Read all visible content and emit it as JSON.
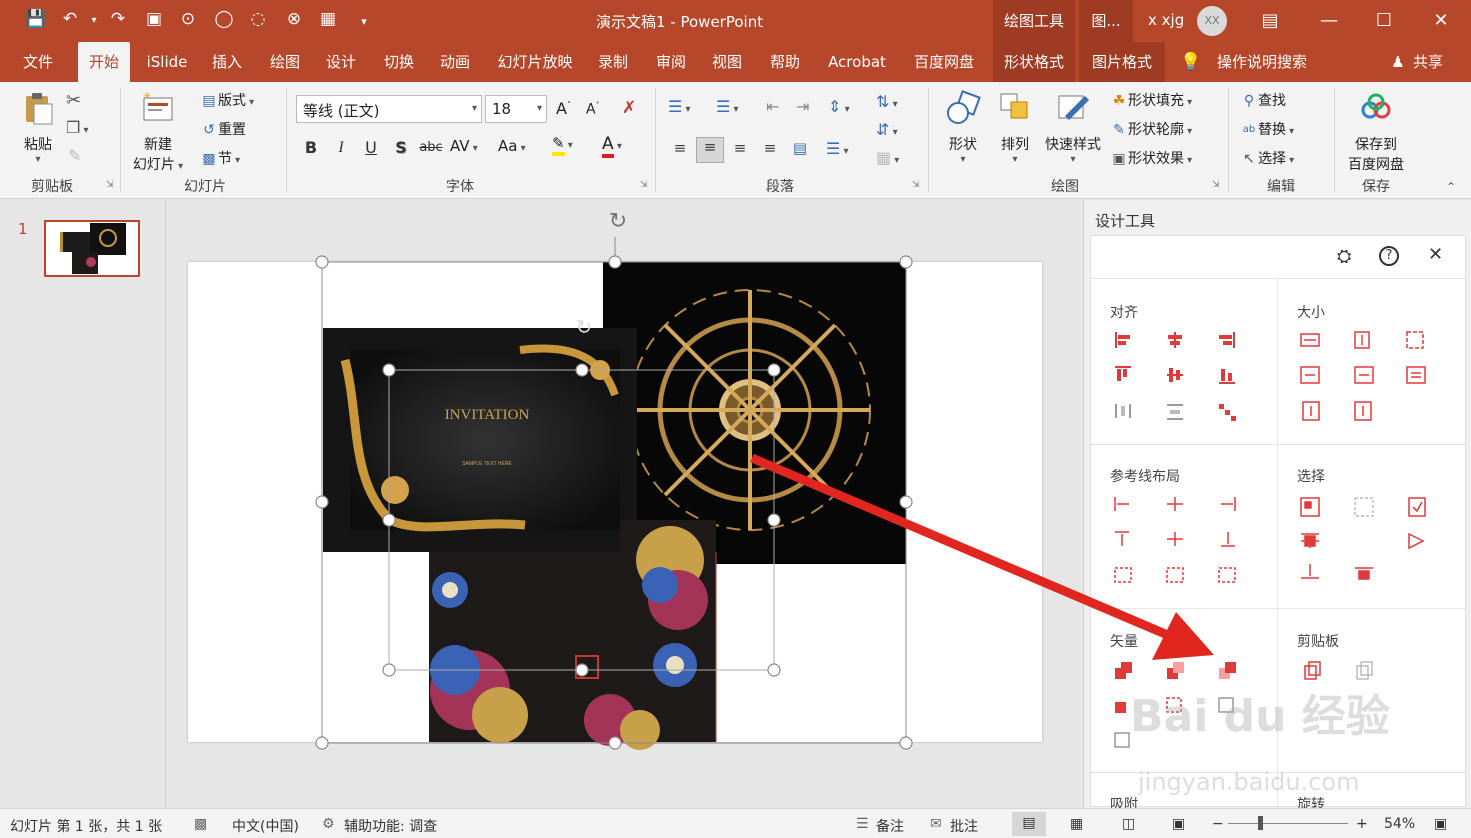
{
  "window": {
    "doc_title": "演示文稿1  -  PowerPoint",
    "context_header_1": "绘图工具",
    "context_header_2": "图...",
    "user_name": "x xjg",
    "user_initials": "XX"
  },
  "tabs": [
    "文件",
    "开始",
    "iSlide",
    "插入",
    "绘图",
    "设计",
    "切换",
    "动画",
    "幻灯片放映",
    "录制",
    "审阅",
    "视图",
    "帮助",
    "Acrobat",
    "百度网盘",
    "形状格式",
    "图片格式"
  ],
  "tell_me": "操作说明搜索",
  "share": "共享",
  "ribbon": {
    "clipboard": {
      "paste": "粘贴",
      "label": "剪贴板"
    },
    "slides": {
      "new_slide_1": "新建",
      "new_slide_2": "幻灯片",
      "layout": "版式",
      "reset": "重置",
      "section": "节",
      "label": "幻灯片"
    },
    "font": {
      "font_name": "等线 (正文)",
      "font_size": "18",
      "label": "字体",
      "bold": "B",
      "italic": "I",
      "underline": "U",
      "shadow": "S",
      "strike": "abc",
      "spacing": "AV",
      "case": "Aa",
      "grow": "A",
      "shrink": "A"
    },
    "paragraph": {
      "label": "段落"
    },
    "drawing": {
      "shapes": "形状",
      "arrange": "排列",
      "quick_styles": "快速样式",
      "fill": "形状填充",
      "outline": "形状轮廓",
      "effects": "形状效果",
      "label": "绘图"
    },
    "editing": {
      "find": "查找",
      "replace": "替换",
      "select": "选择",
      "label": "编辑"
    },
    "save": {
      "save_1": "保存到",
      "save_2": "百度网盘",
      "label": "保存"
    }
  },
  "thumbnail": {
    "number": "1"
  },
  "slide": {
    "invitation_title": "INVITATION",
    "invitation_sub": "SAMPLE TEXT HERE"
  },
  "panel": {
    "title": "设计工具",
    "sections": {
      "align": "对齐",
      "size": "大小",
      "guides": "参考线布局",
      "select": "选择",
      "vector": "矢量",
      "clipboard": "剪贴板",
      "bottom_left": "吸附",
      "bottom_right": "旋转"
    }
  },
  "watermark": {
    "brand": "Bai du 经验",
    "url": "jingyan.baidu.com"
  },
  "status": {
    "slide_info": "幻灯片 第 1 张，共 1 张",
    "language": "中文(中国)",
    "accessibility": "辅助功能: 调查",
    "notes": "备注",
    "comments": "批注",
    "zoom": "54%"
  },
  "colors": {
    "accent": "#b7472a",
    "panel_icon": "#e03a3a",
    "arrow": "#e0261f"
  }
}
